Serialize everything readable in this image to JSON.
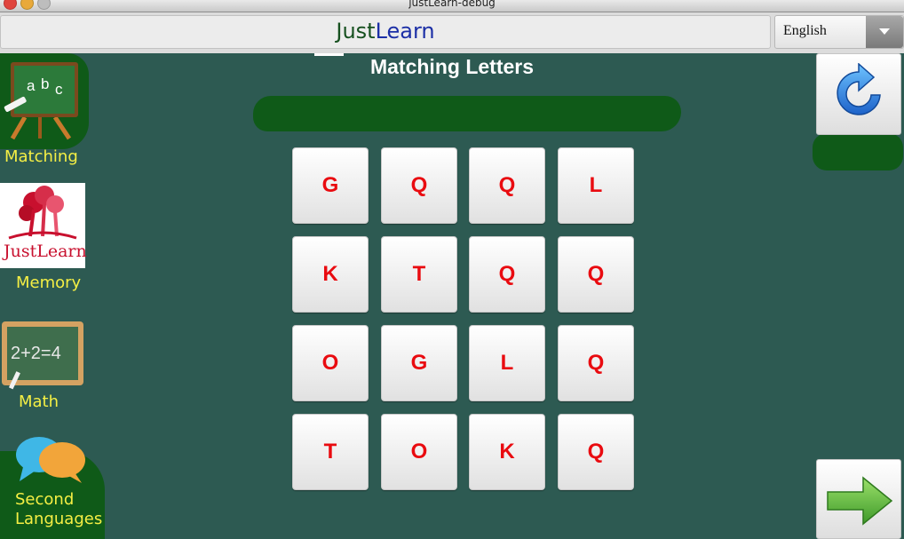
{
  "window": {
    "title": "justLearn-debug"
  },
  "header": {
    "brand_part1": "Just",
    "brand_part2": "Learn",
    "language": "English"
  },
  "main": {
    "heading": "Matching Letters",
    "tiles": [
      [
        "G",
        "Q",
        "Q",
        "L"
      ],
      [
        "K",
        "T",
        "Q",
        "Q"
      ],
      [
        "O",
        "G",
        "L",
        "Q"
      ],
      [
        "T",
        "O",
        "K",
        "Q"
      ]
    ]
  },
  "sidebar": {
    "items": [
      {
        "label": "Matching",
        "icon": "chalkboard-abc-icon"
      },
      {
        "label": "Memory",
        "icon": "justlearn-logo-icon",
        "logo_text": "JustLearn"
      },
      {
        "label": "Math",
        "icon": "chalkboard-math-icon",
        "board_text": "2+2=4"
      },
      {
        "label_line1": "Second",
        "label_line2": "Languages",
        "icon": "speech-bubbles-icon"
      }
    ]
  },
  "actions": {
    "refresh_icon": "refresh-icon",
    "next_icon": "next-arrow-icon"
  },
  "colors": {
    "background": "#2d5a52",
    "tile_letter": "#e90b10",
    "sidebar_label": "#f5ef44",
    "brand_dark": "#16501f",
    "brand_blue": "#1c2fa6"
  }
}
